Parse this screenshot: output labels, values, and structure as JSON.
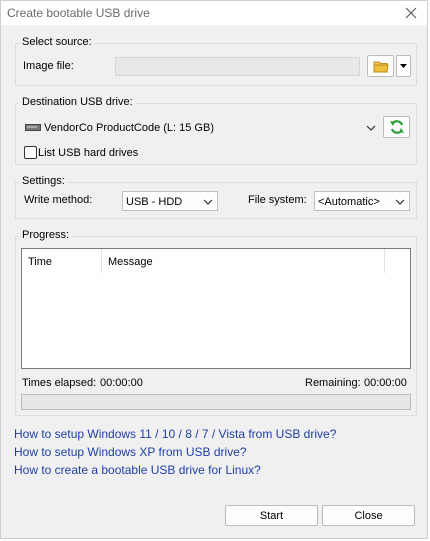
{
  "window": {
    "title": "Create bootable USB drive"
  },
  "source": {
    "legend": "Select source:",
    "image_label": "Image file:",
    "image_value": ""
  },
  "destination": {
    "legend": "Destination USB drive:",
    "drive": "VendorCo ProductCode (L:  15 GB)",
    "list_hdd_label": "List USB hard drives",
    "list_hdd_checked": false
  },
  "settings": {
    "legend": "Settings:",
    "write_method_label": "Write method:",
    "write_method_value": "USB - HDD",
    "fs_label": "File system:",
    "fs_value": "<Automatic>"
  },
  "progress": {
    "legend": "Progress:",
    "columns": [
      "Time",
      "Message"
    ],
    "elapsed_label": "Times elapsed:",
    "elapsed_value": "00:00:00",
    "remaining_label": "Remaining:",
    "remaining_value": "00:00:00",
    "percent": 0
  },
  "links": [
    "How to setup Windows 11 / 10 / 8 / 7 / Vista from USB drive?",
    "How to setup Windows XP from USB drive?",
    "How to create a bootable USB drive for Linux?"
  ],
  "buttons": {
    "start": "Start",
    "close": "Close"
  },
  "icons": {
    "close": "close-icon",
    "browse": "folder-icon",
    "dropdown": "chevron-down-icon",
    "drive": "usb-drive-icon",
    "refresh": "refresh-icon"
  },
  "colors": {
    "link": "#1f3fa6",
    "refresh": "#2e9c3a",
    "folder": "#e8b830"
  }
}
